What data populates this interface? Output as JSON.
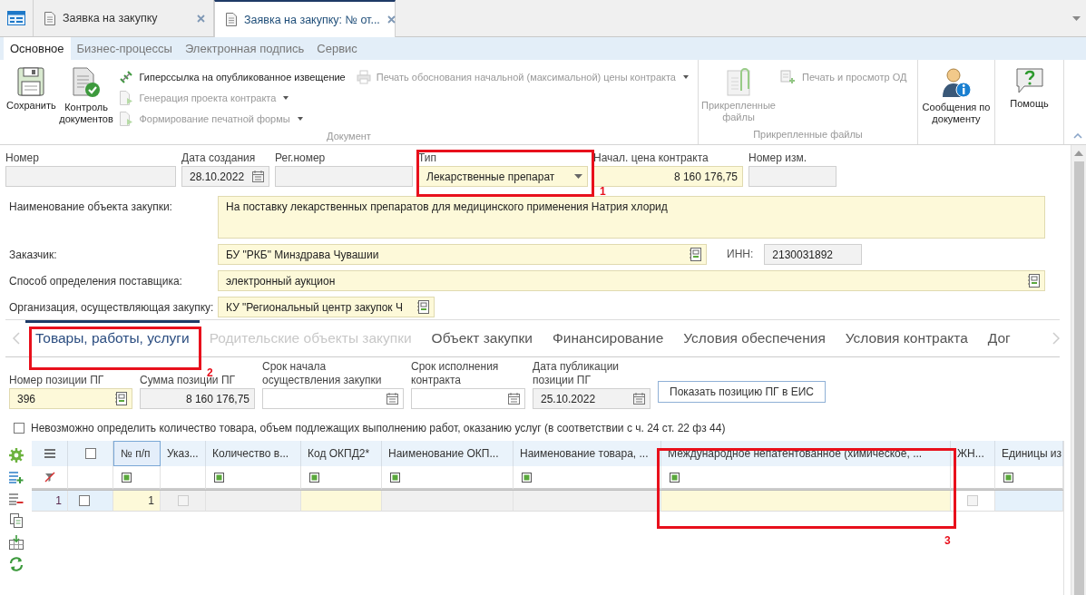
{
  "doc_tabs": [
    {
      "label": "Заявка на закупку",
      "selected": false
    },
    {
      "label": "Заявка на закупку: № от...",
      "selected": true
    }
  ],
  "ribbon_tabs": [
    {
      "label": "Основное",
      "selected": true
    },
    {
      "label": "Бизнес-процессы",
      "selected": false
    },
    {
      "label": "Электронная подпись",
      "selected": false
    },
    {
      "label": "Сервис",
      "selected": false
    }
  ],
  "ribbon_groups": [
    {
      "label": "Документ",
      "large": [
        {
          "kind": "save",
          "label": "Сохранить",
          "disabled": false
        },
        {
          "kind": "check",
          "label": "Контроль документов",
          "disabled": false
        }
      ],
      "small_columns": [
        [
          {
            "kind": "link",
            "label": "Гиперссылка на опубликованное извещение",
            "disabled": false,
            "menu": false
          },
          {
            "kind": "generate",
            "label": "Генерация проекта контракта",
            "disabled": true,
            "menu": true
          },
          {
            "kind": "generate",
            "label": "Формирование печатной формы",
            "disabled": true,
            "menu": true
          }
        ],
        [
          {
            "kind": "print",
            "label": "Печать обоснования начальной (максимальной) цены контракта",
            "disabled": true,
            "menu": true
          }
        ]
      ]
    },
    {
      "label": "Прикрепленные файлы",
      "large": [
        {
          "kind": "attach",
          "label": "Прикрепленные файлы",
          "disabled": true
        }
      ],
      "small_columns": [
        [
          {
            "kind": "printview",
            "label": "Печать и просмотр ОД",
            "disabled": true,
            "menu": false
          }
        ]
      ]
    },
    {
      "large": [
        {
          "kind": "messages",
          "label": "Сообщения по документу",
          "disabled": false
        }
      ]
    },
    {
      "large": [
        {
          "kind": "help",
          "label": "Помощь",
          "disabled": false
        }
      ]
    }
  ],
  "header_fields": [
    {
      "label": "Номер",
      "kind": "text",
      "required": false,
      "readonly": true
    },
    {
      "label": "Дата создания",
      "value": "28.10.2022",
      "kind": "date",
      "required": false,
      "readonly": true
    },
    {
      "label": "Рег.номер",
      "kind": "text",
      "required": false,
      "readonly": true
    },
    {
      "label": "Тип",
      "value": "Лекарственные препарат",
      "kind": "dropdown",
      "required": true,
      "readonly": false
    },
    {
      "label": "Начал. цена контракта",
      "value": "8 160 176,75",
      "kind": "number",
      "required": true,
      "readonly": false
    },
    {
      "label": "Номер изм.",
      "kind": "text",
      "required": false,
      "readonly": true
    }
  ],
  "detail_fields": [
    {
      "label": "Наименование объекта закупки:",
      "value": "На поставку лекарственных препаратов для медицинского применения Натрия хлорид",
      "kind": "memo",
      "required": true,
      "readonly": false
    },
    {
      "label": "Заказчик:",
      "value": "БУ \"РКБ\" Минздрава Чувашии",
      "kind": "lookup",
      "required": true,
      "readonly": false,
      "extra": {
        "label": "ИНН:",
        "value": "2130031892",
        "required": false,
        "readonly": true
      }
    },
    {
      "label": "Способ определения поставщика:",
      "value": "электронный аукцион",
      "kind": "lookup",
      "required": true,
      "readonly": false
    },
    {
      "label": "Организация, осуществляющая закупку:",
      "value": "КУ \"Региональный центр закупок Ч",
      "kind": "lookup",
      "required": true,
      "readonly": false
    }
  ],
  "section_tabs": [
    {
      "label": "Товары, работы, услуги",
      "selected": true,
      "disabled": false
    },
    {
      "label": "Родительские объекты закупки",
      "selected": false,
      "disabled": true
    },
    {
      "label": "Объект закупки",
      "selected": false,
      "disabled": false
    },
    {
      "label": "Финансирование",
      "selected": false,
      "disabled": false
    },
    {
      "label": "Условия обеспечения",
      "selected": false,
      "disabled": false
    },
    {
      "label": "Условия контракта",
      "selected": false,
      "disabled": false
    },
    {
      "label": "Дог",
      "selected": false,
      "disabled": false
    }
  ],
  "position_fields": [
    {
      "label": "Номер позиции ПГ",
      "value": "396",
      "kind": "lookup",
      "required": true,
      "readonly": false
    },
    {
      "label": "Сумма позиции ПГ",
      "value": "8 160 176,75",
      "kind": "number",
      "required": false,
      "readonly": true
    },
    {
      "label": "Срок начала осуществления закупки",
      "kind": "date",
      "required": false,
      "readonly": false
    },
    {
      "label": "Срок исполнения контракта",
      "kind": "date",
      "required": false,
      "readonly": false
    },
    {
      "label": "Дата публикации позиции ПГ",
      "value": "25.10.2022",
      "kind": "date",
      "required": false,
      "readonly": true
    }
  ],
  "show_button": "Показать позицию ПГ в ЕИС",
  "undefined_quantity": {
    "label": "Невозможно определить количество товара, объем подлежащих выполнению работ, оказанию услуг (в соответствии с ч. 24 ст. 22 фз 44)",
    "checked": false
  },
  "grid": {
    "columns": [
      {
        "kind": "menu",
        "selected": false
      },
      {
        "kind": "check",
        "checked": false,
        "selected": false
      },
      {
        "kind": "text",
        "label": "№ п/п",
        "selected": true,
        "filter": true
      },
      {
        "kind": "text",
        "label": "Указ...",
        "selected": false,
        "filter": false
      },
      {
        "kind": "text",
        "label": "Количество в...",
        "selected": false,
        "filter": true
      },
      {
        "kind": "text",
        "label": "Код ОКПД2*",
        "selected": false,
        "filter": true
      },
      {
        "kind": "text",
        "label": "Наименование ОКП...",
        "selected": false,
        "filter": true
      },
      {
        "kind": "text",
        "label": "Наименование товара, ...",
        "selected": false,
        "filter": true
      },
      {
        "kind": "text",
        "label": "Международное непатентованное (химическое, ...",
        "selected": false,
        "filter": true
      },
      {
        "kind": "text",
        "label": "ЖН...",
        "selected": false,
        "filter": false
      },
      {
        "kind": "text",
        "label": "Единицы из",
        "selected": false,
        "filter": true
      }
    ],
    "rows": [
      {
        "selected": true,
        "cells": [
          {
            "kind": "rownum",
            "text": "1"
          },
          {
            "kind": "check",
            "checked": false,
            "disabled": false
          },
          {
            "kind": "text",
            "text": "1",
            "focused": false,
            "editable": true,
            "readonly": false
          },
          {
            "kind": "check",
            "checked": false,
            "disabled": true,
            "readonly": true
          },
          {
            "kind": "text",
            "focused": false,
            "editable": false,
            "readonly": true
          },
          {
            "kind": "text",
            "focused": false,
            "editable": true,
            "readonly": false
          },
          {
            "kind": "text",
            "focused": false,
            "editable": false,
            "readonly": true
          },
          {
            "kind": "text",
            "focused": false,
            "editable": false,
            "readonly": true
          },
          {
            "kind": "text",
            "focused": false,
            "editable": true,
            "readonly": false
          },
          {
            "kind": "check",
            "checked": false,
            "disabled": true,
            "readonly": false
          },
          {
            "kind": "text",
            "focused": true,
            "editable": false,
            "readonly": false
          }
        ]
      }
    ]
  },
  "annotations": [
    {
      "label": "1"
    },
    {
      "label": "2"
    },
    {
      "label": "3"
    }
  ]
}
